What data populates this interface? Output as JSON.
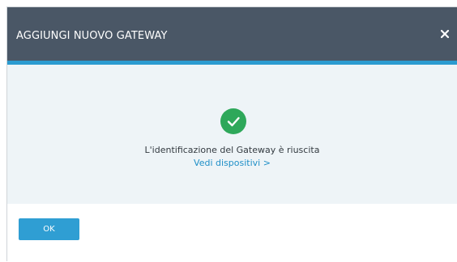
{
  "dialog": {
    "title": "AGGIUNGI NUOVO GATEWAY",
    "close_icon": "close-icon"
  },
  "body": {
    "status_icon": "check-circle-icon",
    "message": "L'identificazione del Gateway è riuscita",
    "link_label": "Vedi dispositivi >"
  },
  "footer": {
    "ok_label": "OK"
  },
  "colors": {
    "header_bg": "#4a5766",
    "accent": "#2b9bd0",
    "body_bg": "#eef4f7",
    "success": "#2ea85a",
    "link": "#1f8fc7",
    "button_bg": "#2f9ed3"
  }
}
